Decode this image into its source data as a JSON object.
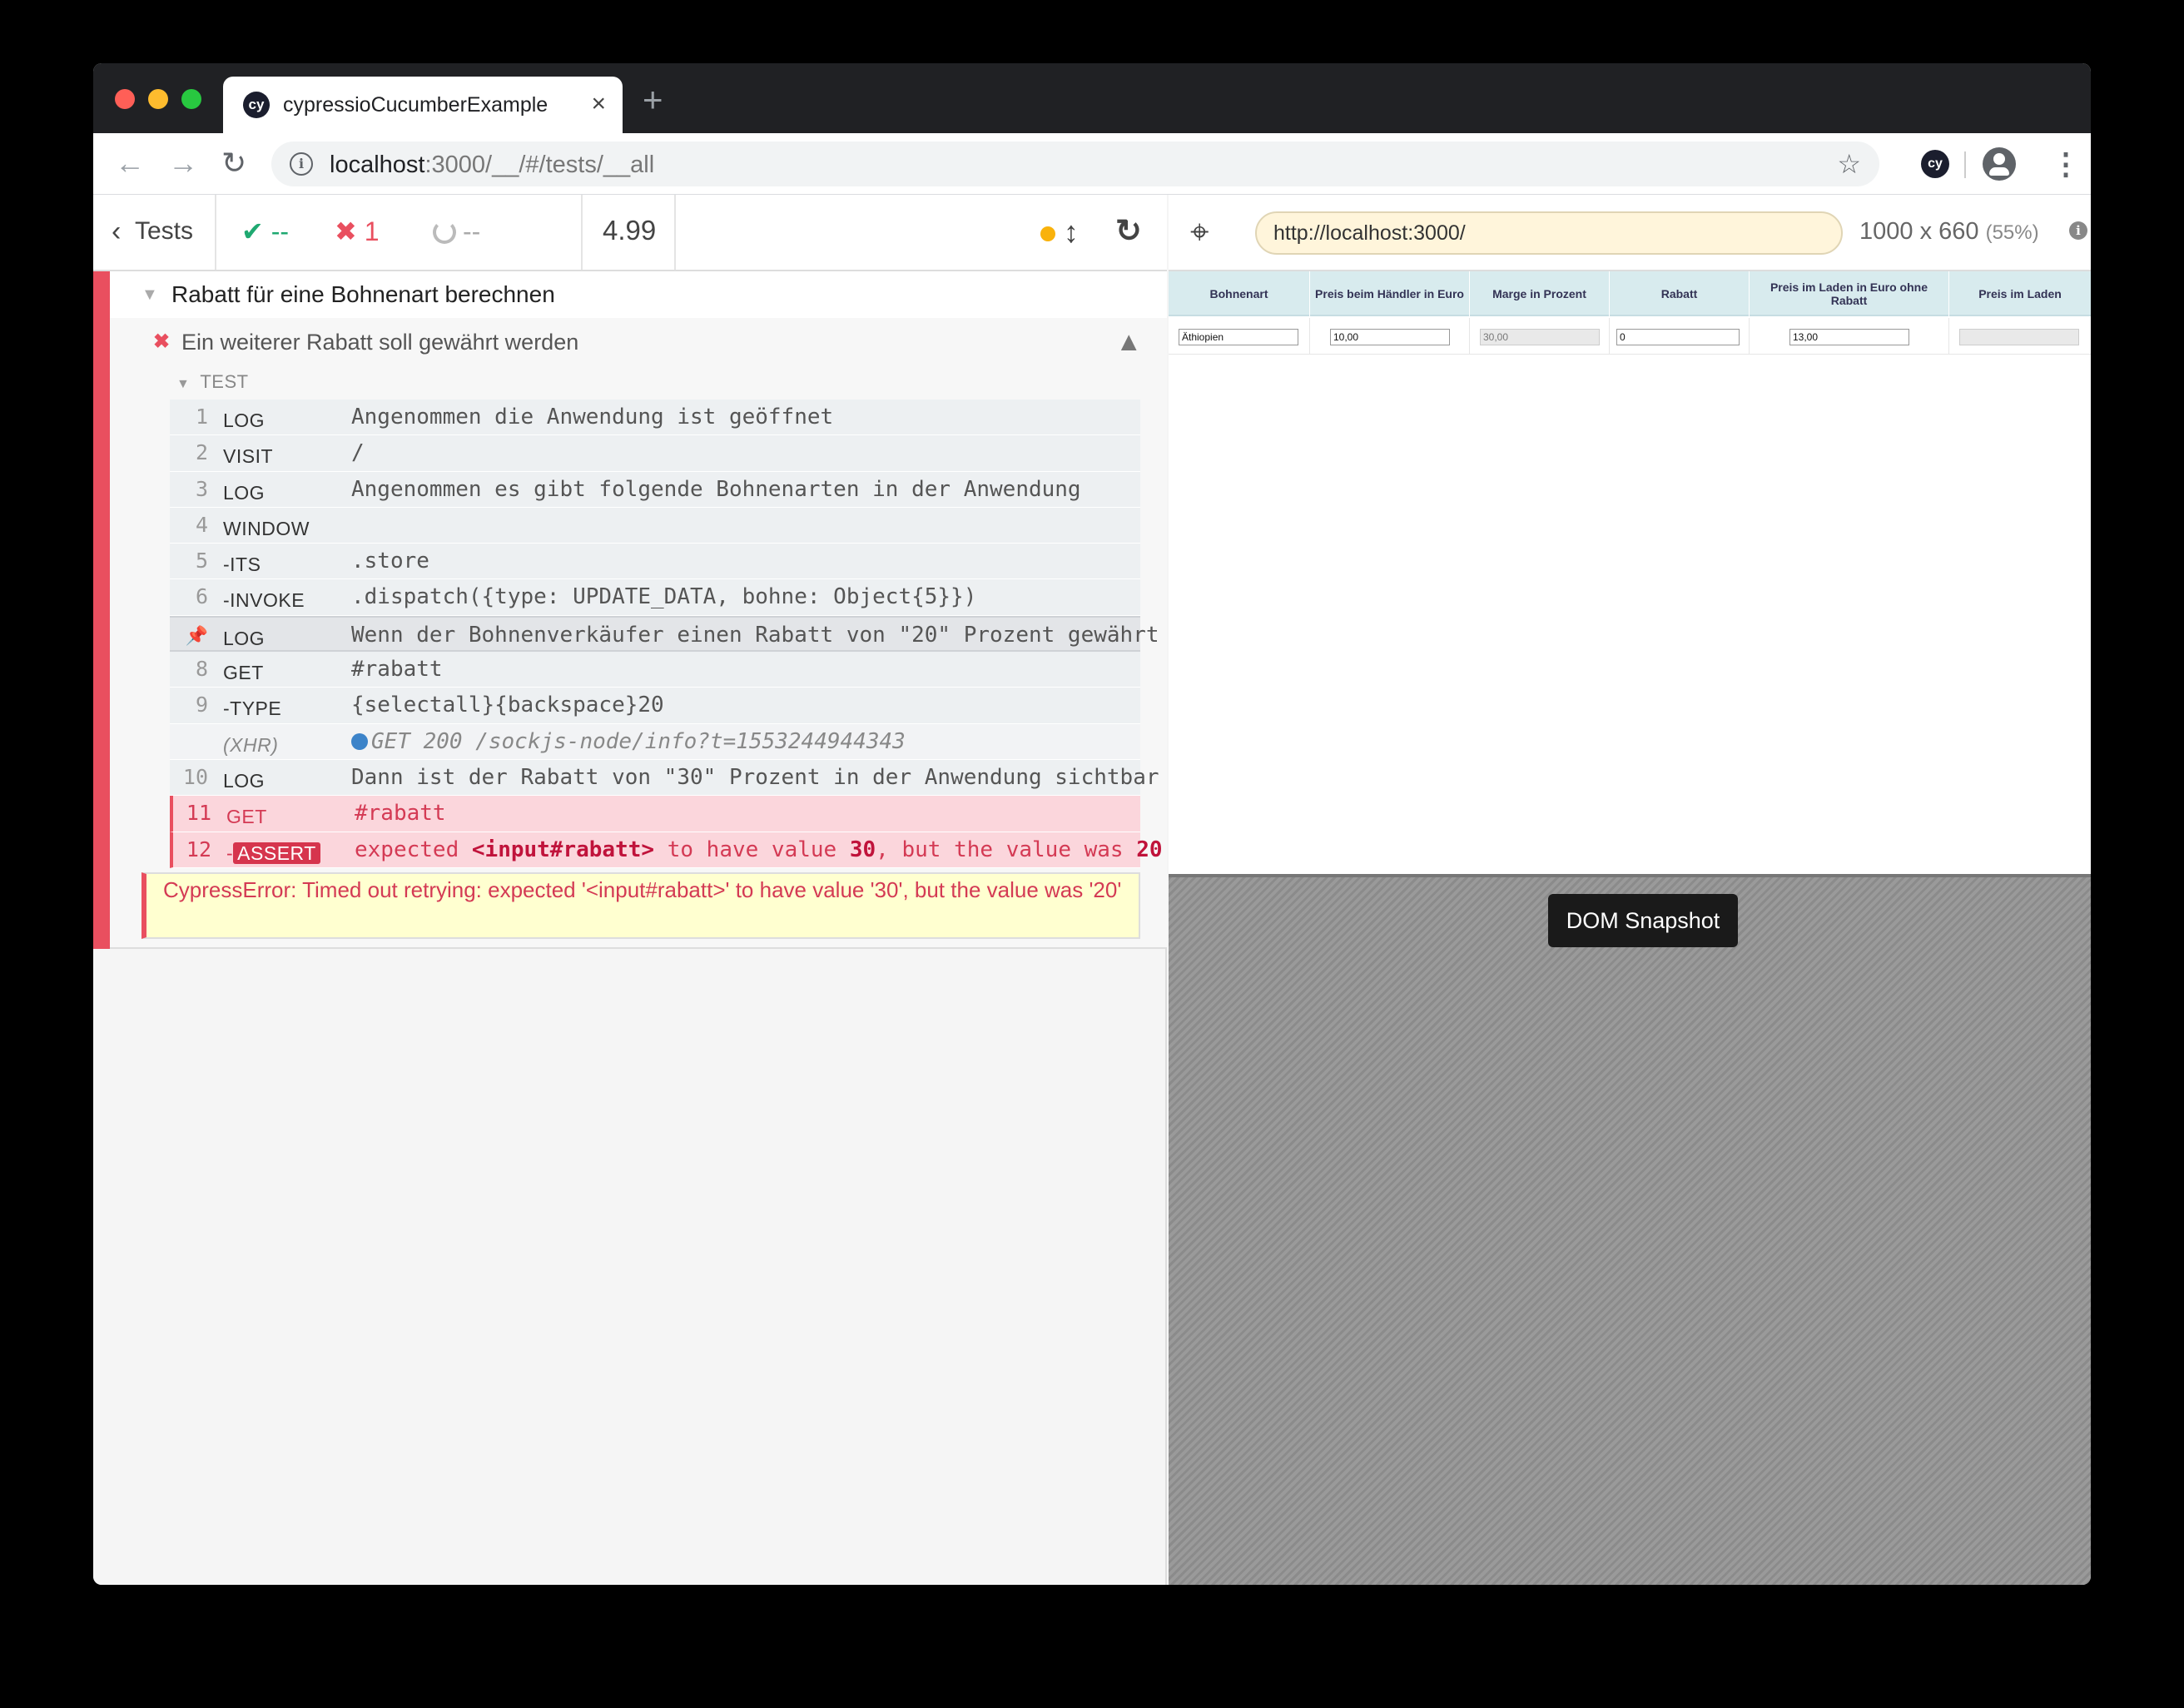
{
  "browser": {
    "tab_title": "cypressioCucumberExample",
    "tab_favicon": "cy",
    "new_tab_label": "+",
    "url_host": "localhost",
    "url_path": ":3000/__/#/tests/__all",
    "extension_label": "cy"
  },
  "reporter": {
    "tests_label": "Tests",
    "stats": {
      "passed": "--",
      "failed": "1",
      "pending": "--"
    },
    "duration": "4.99",
    "suite_title": "Rabatt für eine Bohnenart berechnen",
    "test_title": "Ein weiterer Rabatt soll gewährt werden",
    "test_section_label": "TEST",
    "commands": [
      {
        "num": "1",
        "name": "LOG",
        "msg": "Angenommen die Anwendung ist geöffnet"
      },
      {
        "num": "2",
        "name": "VISIT",
        "msg": "/"
      },
      {
        "num": "3",
        "name": "LOG",
        "msg": "Angenommen es gibt folgende Bohnenarten in der Anwendung"
      },
      {
        "num": "4",
        "name": "WINDOW",
        "msg": ""
      },
      {
        "num": "5",
        "name": "-ITS",
        "msg": ".store"
      },
      {
        "num": "6",
        "name": "-INVOKE",
        "msg": ".dispatch({type: UPDATE_DATA, bohne: Object{5}})"
      },
      {
        "num": "",
        "name": "LOG",
        "msg": "Wenn der Bohnenverkäufer einen Rabatt von \"20\" Prozent gewährt"
      },
      {
        "num": "8",
        "name": "GET",
        "msg": "#rabatt"
      },
      {
        "num": "9",
        "name": "-TYPE",
        "msg": "{selectall}{backspace}20"
      },
      {
        "num": "",
        "name": "(XHR)",
        "msg": "GET 200 /sockjs-node/info?t=1553244944343"
      },
      {
        "num": "10",
        "name": "LOG",
        "msg": "Dann ist der Rabatt von \"30\" Prozent in der Anwendung sichtbar"
      },
      {
        "num": "11",
        "name": "GET",
        "msg": "#rabatt"
      }
    ],
    "assert": {
      "num": "12",
      "dash": "-",
      "name": "ASSERT",
      "w1": "expected",
      "subject": "<input#rabatt>",
      "w2": "to have value",
      "expected_value": "30",
      "w3": ", but the value was",
      "actual_value": "20"
    },
    "error": "CypressError: Timed out retrying: expected '<input#rabatt>' to have value '30', but the value was '20'"
  },
  "aut": {
    "url": "http://localhost:3000/",
    "viewport": "1000 x 660",
    "scale": "(55%)",
    "table": {
      "headers": [
        "Bohnenart",
        "Preis beim Händler in Euro",
        "Marge in Prozent",
        "Rabatt",
        "Preis im Laden in Euro ohne Rabatt",
        "Preis im Laden"
      ],
      "row": [
        "Äthiopien",
        "10,00",
        "30,00",
        "0",
        "13,00",
        ""
      ]
    },
    "snapshot_label": "DOM Snapshot"
  }
}
